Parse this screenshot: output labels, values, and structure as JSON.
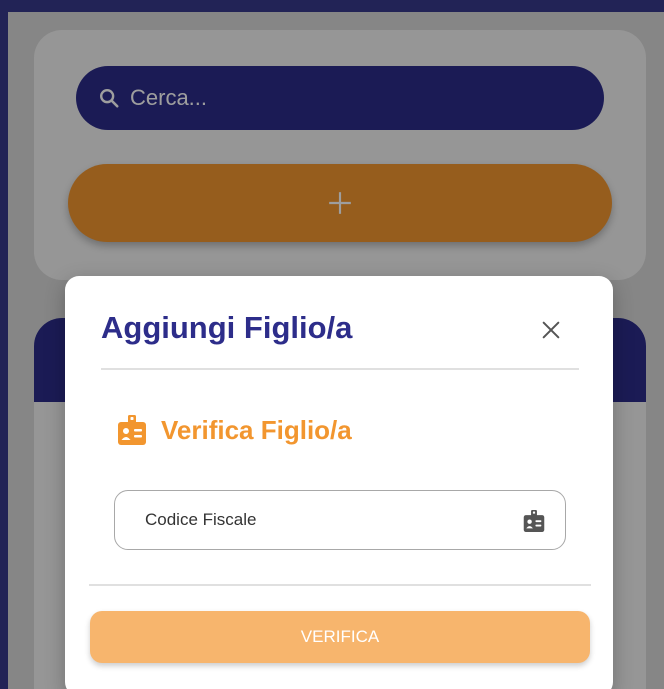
{
  "search": {
    "placeholder": "Cerca...",
    "icon": "search-icon"
  },
  "add_button": {
    "icon": "plus-icon",
    "color": "#f2962f"
  },
  "modal": {
    "title": "Aggiungi Figlio/a",
    "close_icon": "close-icon",
    "section_title": "Verifica Figlio/a",
    "section_icon": "id-badge-icon",
    "field_placeholder": "Codice Fiscale",
    "field_icon": "id-badge-icon",
    "verify_label": "VERIFICA"
  },
  "colors": {
    "primary": "#2d2d8a",
    "accent": "#f2962f",
    "accent_disabled": "#f7b56d"
  }
}
